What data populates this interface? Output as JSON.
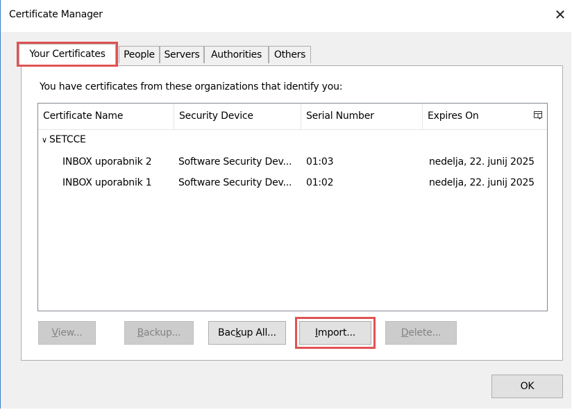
{
  "window": {
    "title": "Certificate Manager",
    "close_glyph": "✕"
  },
  "tabs": [
    {
      "label": "Your Certificates",
      "active": true
    },
    {
      "label": "People"
    },
    {
      "label": "Servers"
    },
    {
      "label": "Authorities"
    },
    {
      "label": "Others"
    }
  ],
  "panel": {
    "caption": "You have certificates from these organizations that identify you:"
  },
  "table": {
    "columns": [
      "Certificate Name",
      "Security Device",
      "Serial Number",
      "Expires On"
    ],
    "column_picker_icon": "column-picker-icon",
    "group": {
      "name": "SETCCE",
      "chevron": "∨",
      "expanded": true
    },
    "rows": [
      {
        "name": "INBOX uporabnik 2",
        "device": "Software Security Dev...",
        "serial": "01:03",
        "expires": "nedelja, 22. junij 2025"
      },
      {
        "name": "INBOX uporabnik 1",
        "device": "Software Security Dev...",
        "serial": "01:02",
        "expires": "nedelja, 22. junij 2025"
      }
    ]
  },
  "buttons": {
    "view": {
      "label_u": "V",
      "label_rest": "iew...",
      "disabled": true
    },
    "backup": {
      "label_u": "B",
      "label_rest": "ackup...",
      "disabled": true
    },
    "backup_all": {
      "label_pre": "Bac",
      "label_u": "k",
      "label_rest": "up All...",
      "disabled": false
    },
    "import": {
      "label_u": "I",
      "label_pre_u": "",
      "label_mid": "m",
      "label_rest": "port...",
      "disabled": false
    },
    "delete": {
      "label_u": "D",
      "label_rest": "elete...",
      "disabled": true
    },
    "ok": {
      "label": "OK"
    }
  },
  "highlight_color": "#e05252"
}
